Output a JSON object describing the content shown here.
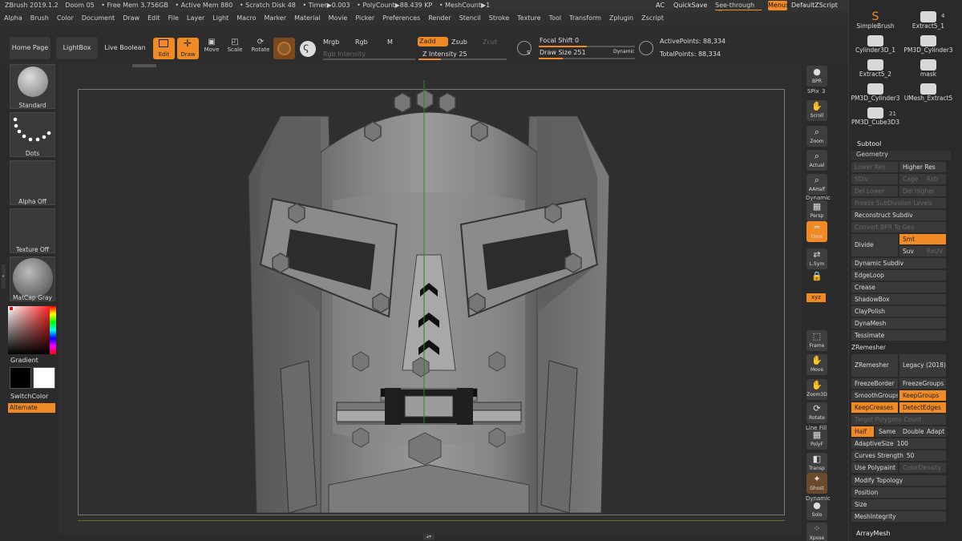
{
  "titlebar": {
    "app": "ZBrush 2019.1.2",
    "doc": "Doom 05",
    "free_mem": "• Free Mem 3.756GB",
    "active_mem": "• Active Mem 880",
    "scratch": "• Scratch Disk 48",
    "timer": "• Timer▶0.003",
    "polycount": "• PolyCount▶88.439 KP",
    "meshcount": "• MeshCount▶1"
  },
  "menubar": {
    "items": [
      "Alpha",
      "Brush",
      "Color",
      "Document",
      "Draw",
      "Edit",
      "File",
      "Layer",
      "Light",
      "Macro",
      "Marker",
      "Material",
      "Movie",
      "Picker",
      "Preferences",
      "Render",
      "Stencil",
      "Stroke",
      "Texture",
      "Tool",
      "Transform",
      "Zplugin",
      "Zscript"
    ],
    "ac": "AC",
    "quicksave": "QuickSave",
    "seethrough": "See-through",
    "seethrough_value": "0",
    "menus": "Menus",
    "defaultscript": "DefaultZScript"
  },
  "toolbar": {
    "home_page": "Home Page",
    "lightbox": "LightBox",
    "live_boolean": "Live Boolean",
    "edit": "Edit",
    "draw": "Draw",
    "move": "Move",
    "scale": "Scale",
    "rotate": "Rotate",
    "mrgb": "Mrgb",
    "rgb": "Rgb",
    "m": "M",
    "zadd": "Zadd",
    "zsub": "Zsub",
    "zcut": "Zcut",
    "rgb_intensity": "Rgb Intensity",
    "z_intensity_label": "Z Intensity",
    "z_intensity_value": "25",
    "focal_shift_label": "Focal Shift",
    "focal_shift_value": "0",
    "draw_size_label": "Draw Size",
    "draw_size_value": "251",
    "dynamic": "Dynamic",
    "active_points": "ActivePoints: 88,334",
    "total_points": "TotalPoints: 88,334",
    "focal_slider": 0.5,
    "drawsize_slider": 0.25,
    "zint_slider": 0.25
  },
  "leftshelf": {
    "standard": "Standard",
    "dots": "Dots",
    "alpha_off": "Alpha Off",
    "texture_off": "Texture Off",
    "matcap": "MatCap Gray",
    "gradient": "Gradient",
    "switchcolor": "SwitchColor",
    "alternate": "Alternate"
  },
  "rightshelf": {
    "bpr": "BPR",
    "spix_label": "SPix",
    "spix_value": "3",
    "scroll": "Scroll",
    "zoom": "Zoom",
    "actual": "Actual",
    "aahalf": "AAHalf",
    "dynamic": "Dynamic",
    "persp": "Persp",
    "floor": "Floor",
    "lsym": "L.Sym",
    "xyz": "xyz",
    "frame": "Frame",
    "move": "Move",
    "zoom3d": "Zoom3D",
    "rotate": "Rotate",
    "linefill": "Line Fill",
    "polyf": "PolyF",
    "transp": "Transp",
    "ghost": "Ghost",
    "dynamic2": "Dynamic",
    "solo": "Solo",
    "xpose": "Xpose"
  },
  "palette": {
    "count_top": "4",
    "tools": [
      "SimpleBrush",
      "Extract5_1",
      "Cylinder3D_1",
      "PM3D_Cylinder3",
      "Extract5_2",
      "mask",
      "PM3D_Cylinder3",
      "UMesh_Extract5",
      "PM3D_Cube3D3"
    ],
    "count_21": "21",
    "subtool": "Subtool",
    "geometry": "Geometry",
    "lower_res": "Lower Res",
    "higher_res": "Higher Res",
    "sdiv": "SDiv",
    "cage": "Cage",
    "rstr": "Rstr",
    "del_lower": "Del Lower",
    "del_higher": "Del Higher",
    "freeze_subdiv": "Freeze SubDivision Levels",
    "reconstruct": "Reconstruct Subdiv",
    "convert_bpr": "Convert BPR To Geo",
    "divide": "Divide",
    "smt": "Smt",
    "suv": "Suv",
    "reuv": "ReUV",
    "dynamic_subdiv": "Dynamic Subdiv",
    "edgeloop": "EdgeLoop",
    "crease": "Crease",
    "shadowbox": "ShadowBox",
    "claypolish": "ClayPolish",
    "dynamesh": "DynaMesh",
    "tessimate": "Tessimate",
    "zremesher_section": "ZRemesher",
    "zremesher": "ZRemesher",
    "legacy": "Legacy (2018)",
    "freezeborder": "FreezeBorder",
    "freezegroups": "FreezeGroups",
    "smoothgroups": "SmoothGroups",
    "keepgroups": "KeepGroups",
    "keepcreases": "KeepCreases",
    "detectedges": "DetectEdges",
    "target_poly": "Target Polygons Count",
    "half": "Half",
    "same": "Same",
    "double": "Double",
    "adapt": "Adapt",
    "adaptivesize_label": "AdaptiveSize",
    "adaptivesize_value": "100",
    "curves_label": "Curves Strength",
    "curves_value": "50",
    "use_polypaint": "Use Polypaint",
    "colordensity": "ColorDensity",
    "modify_topology": "Modify Topology",
    "position": "Position",
    "size": "Size",
    "meshintegrity": "MeshIntegrity",
    "arraymesh": "ArrayMesh"
  },
  "colors": {
    "accent": "#f08a24",
    "bg": "#2b2b2b",
    "canvas": "#2f2f2f",
    "mask": "#8a8a8a"
  }
}
